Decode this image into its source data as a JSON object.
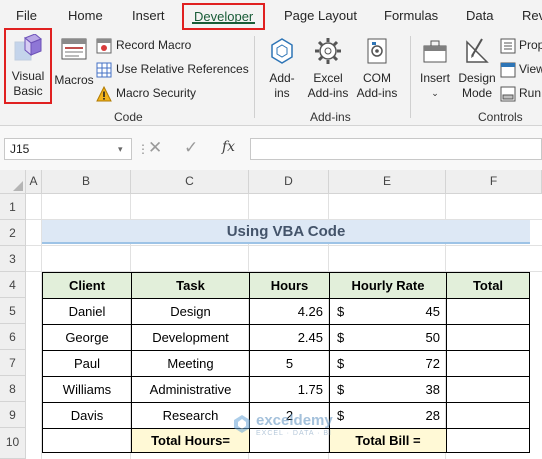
{
  "ribbon_tabs": [
    "File",
    "Home",
    "Insert",
    "Developer",
    "Page Layout",
    "Formulas",
    "Data",
    "Rev"
  ],
  "ribbon": {
    "code": {
      "visual_basic": [
        "Visual",
        "Basic"
      ],
      "macros": "Macros",
      "record_macro": "Record Macro",
      "use_relative_references": "Use Relative References",
      "macro_security": "Macro Security",
      "group_label": "Code"
    },
    "addins": {
      "addins": [
        "Add-",
        "ins"
      ],
      "excel_addins": [
        "Excel",
        "Add-ins"
      ],
      "com_addins": [
        "COM",
        "Add-ins"
      ],
      "group_label": "Add-ins"
    },
    "controls": {
      "insert": "Insert",
      "design_mode": [
        "Design",
        "Mode"
      ],
      "properties": "Prop",
      "view_code": "View",
      "run_dialog": "Run",
      "group_label": "Controls"
    }
  },
  "formula_bar": {
    "name_box": "J15",
    "fx": "fx",
    "formula": ""
  },
  "columns": [
    "A",
    "B",
    "C",
    "D",
    "E",
    "F"
  ],
  "rows": [
    "1",
    "2",
    "3",
    "4",
    "5",
    "6",
    "7",
    "8",
    "9",
    "10"
  ],
  "sheet": {
    "title": "Using VBA Code",
    "headers": [
      "Client",
      "Task",
      "Hours",
      "Hourly Rate",
      "Total"
    ],
    "currency_symbol": "$",
    "data": [
      {
        "client": "Daniel",
        "task": "Design",
        "hours": "4.26",
        "rate": "45"
      },
      {
        "client": "George",
        "task": "Development",
        "hours": "2.45",
        "rate": "50"
      },
      {
        "client": "Paul",
        "task": "Meeting",
        "hours": "5",
        "rate": "72"
      },
      {
        "client": "Williams",
        "task": "Administrative",
        "hours": "1.75",
        "rate": "38"
      },
      {
        "client": "Davis",
        "task": "Research",
        "hours": "2",
        "rate": "28"
      }
    ],
    "total_hours_label": "Total Hours=",
    "total_bill_label": "Total Bill ="
  },
  "watermark": {
    "name": "exceldemy",
    "tagline": "EXCEL · DATA · BI"
  },
  "colors": {
    "accent_green": "#185c37",
    "highlight_red": "#e02020",
    "title_fill": "#dde8f5",
    "header_fill": "#e2efda",
    "total_fill": "#fff9d6"
  }
}
